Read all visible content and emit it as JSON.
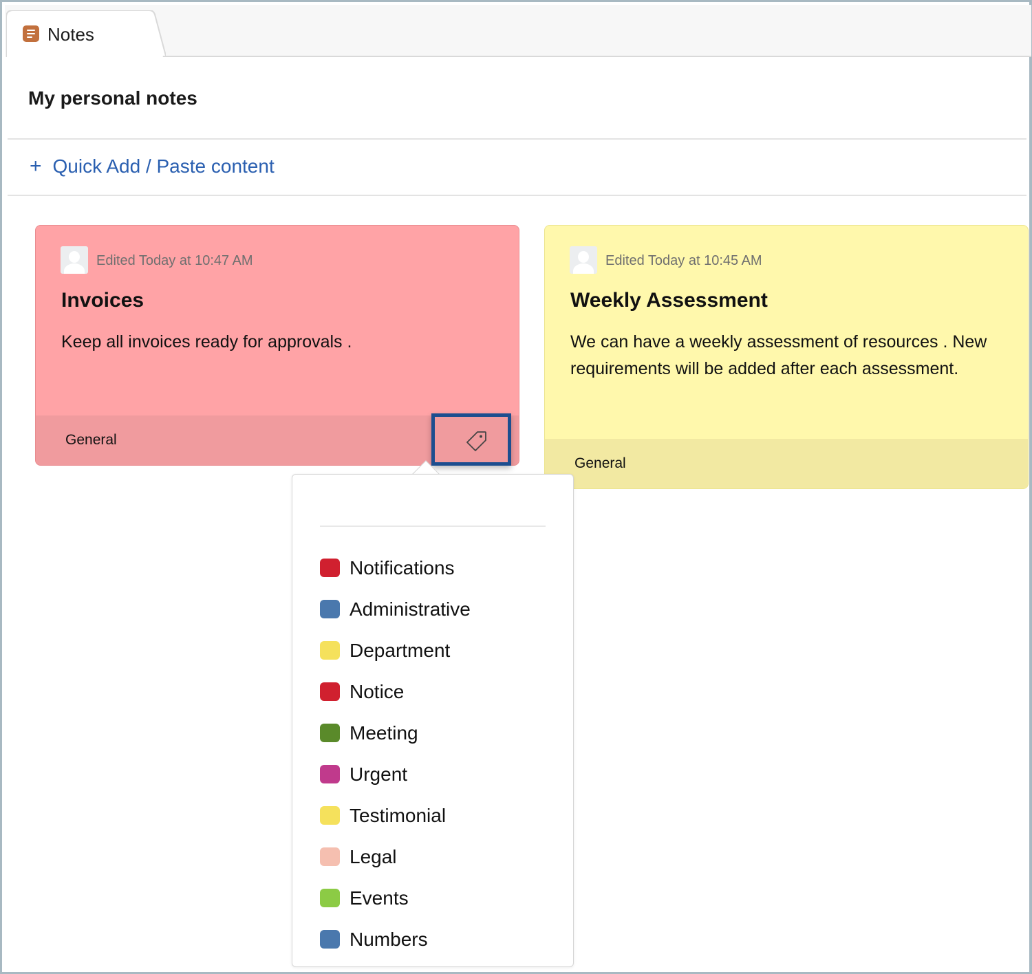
{
  "tab": {
    "label": "Notes",
    "icon": "notes-icon"
  },
  "page": {
    "title": "My personal notes"
  },
  "quick_add": {
    "plus": "+",
    "label": "Quick Add / Paste content"
  },
  "notes": [
    {
      "edited": "Edited Today at 10:47 AM",
      "title": "Invoices",
      "body": "Keep all invoices ready for approvals .",
      "category": "General",
      "color": "#ffa3a6"
    },
    {
      "edited": "Edited Today at 10:45 AM",
      "title": "Weekly Assessment",
      "body": "We can have a weekly assessment of resources . New requirements will be added after each assessment.",
      "category": "General",
      "color": "#fff8ac"
    }
  ],
  "tag_menu": {
    "items": [
      {
        "name": "Notifications",
        "color": "#d0202f"
      },
      {
        "name": "Administrative",
        "color": "#4a78ad"
      },
      {
        "name": "Department",
        "color": "#f5e15c"
      },
      {
        "name": "Notice",
        "color": "#d0202f"
      },
      {
        "name": "Meeting",
        "color": "#5a8a2a"
      },
      {
        "name": "Urgent",
        "color": "#c03a8c"
      },
      {
        "name": "Testimonial",
        "color": "#f5e15c"
      },
      {
        "name": "Legal",
        "color": "#f5bfb0"
      },
      {
        "name": "Events",
        "color": "#8ccb45"
      },
      {
        "name": "Numbers",
        "color": "#4a78ad"
      }
    ]
  }
}
